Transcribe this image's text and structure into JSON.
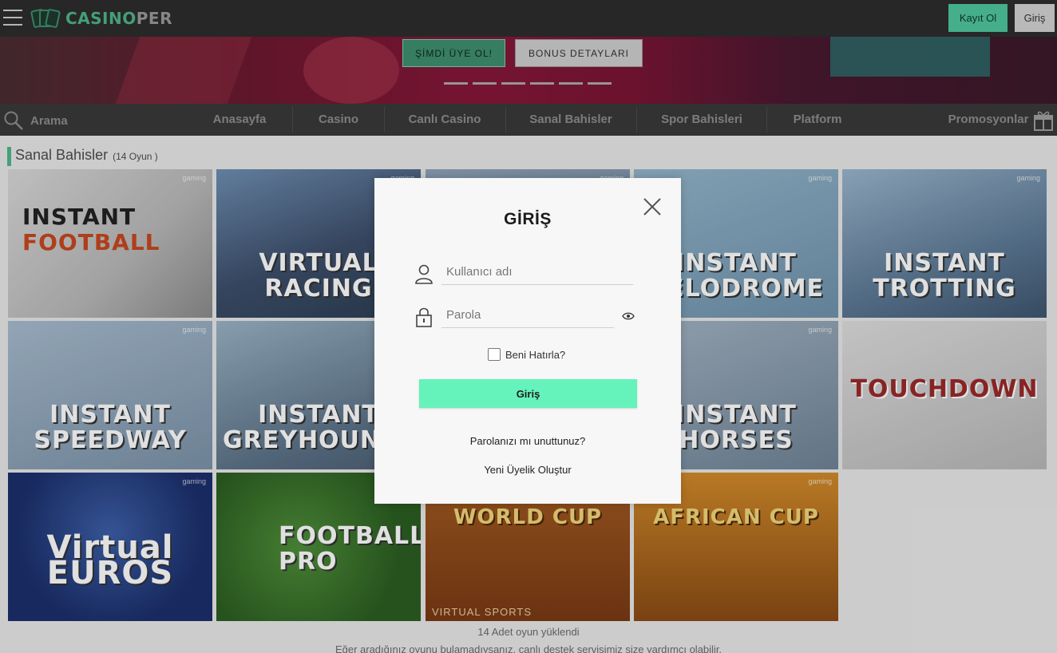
{
  "header": {
    "logo_part1": "CASINO",
    "logo_part2": "PER",
    "register_label": "Kayıt Ol",
    "login_label": "Giriş"
  },
  "banner": {
    "join_label": "ŞİMDİ ÜYE OL!",
    "bonus_label": "BONUS DETAYLARI"
  },
  "nav": {
    "search_label": "Arama",
    "items": [
      {
        "label": "Anasayfa"
      },
      {
        "label": "Casino"
      },
      {
        "label": "Canlı Casino"
      },
      {
        "label": "Sanal Bahisler"
      },
      {
        "label": "Spor Bahisleri"
      },
      {
        "label": "Platform"
      },
      {
        "label": "Promosyonlar"
      }
    ]
  },
  "section": {
    "title": "Sanal Bahisler",
    "count": "(14 Oyun )"
  },
  "games": [
    {
      "name_line1": "INSTANT",
      "name_line2": "FOOTBALL",
      "brand": "gaming"
    },
    {
      "name": "VIRTUAL RACING",
      "brand": "gaming"
    },
    {
      "name": "",
      "brand": "gaming"
    },
    {
      "name": "INSTANT VELODROME",
      "brand": "gaming"
    },
    {
      "name": "INSTANT TROTTING",
      "brand": "gaming"
    },
    {
      "name": "INSTANT SPEEDWAY",
      "brand": "gaming"
    },
    {
      "name": "INSTANT GREYHOUNDS",
      "brand": ""
    },
    {
      "name": "",
      "brand": ""
    },
    {
      "name": "INSTANT HORSES",
      "brand": "gaming"
    },
    {
      "name": "TOUCHDOWN",
      "brand": ""
    },
    {
      "name": "Virtual EUROS",
      "brand": "gaming"
    },
    {
      "name": "FOOTBALL PRO",
      "brand": ""
    },
    {
      "name": "WORLD CUP",
      "sub": "VIRTUAL SPORTS",
      "brand": ""
    },
    {
      "name": "AFRICAN CUP",
      "brand": "gaming"
    }
  ],
  "footer": {
    "loaded_text": "14 Adet oyun yüklendi",
    "help_text": "Eğer aradığınız oyunu bulamadıysanız, canlı destek servisimiz size yardımcı olabilir."
  },
  "login_modal": {
    "title": "GİRİŞ",
    "username_placeholder": "Kullanıcı adı",
    "password_placeholder": "Parola",
    "remember_label": "Beni Hatırla?",
    "submit_label": "Giriş",
    "forgot_label": "Parolanızı mı unuttunuz?",
    "new_account_label": "Yeni Üyelik Oluştur"
  },
  "colors": {
    "accent": "#4fb58a",
    "submit": "#66f2bb",
    "topbar": "#2d2d2d",
    "nav": "#3a3a3a"
  }
}
